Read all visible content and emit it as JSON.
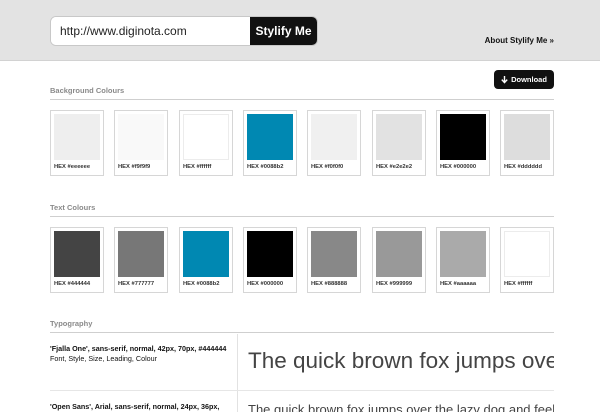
{
  "header": {
    "url_value": "http://www.diginota.com",
    "stylify_label": "Stylify Me",
    "about_label": "About Stylify Me »"
  },
  "download": {
    "label": "Download",
    "icon": "arrow-down-icon"
  },
  "background_section": {
    "title": "Background Colours",
    "swatches": [
      {
        "label": "HEX #eeeeee",
        "color": "#eeeeee"
      },
      {
        "label": "HEX #f9f9f9",
        "color": "#f9f9f9"
      },
      {
        "label": "HEX #ffffff",
        "color": "#ffffff"
      },
      {
        "label": "HEX #0088b2",
        "color": "#0088b2"
      },
      {
        "label": "HEX #f0f0f0",
        "color": "#f0f0f0"
      },
      {
        "label": "HEX #e2e2e2",
        "color": "#e2e2e2"
      },
      {
        "label": "HEX #000000",
        "color": "#000000"
      },
      {
        "label": "HEX #dddddd",
        "color": "#dddddd"
      }
    ]
  },
  "text_section": {
    "title": "Text Colours",
    "swatches": [
      {
        "label": "HEX #444444",
        "color": "#444444"
      },
      {
        "label": "HEX #777777",
        "color": "#777777"
      },
      {
        "label": "HEX #0088b2",
        "color": "#0088b2"
      },
      {
        "label": "HEX #000000",
        "color": "#000000"
      },
      {
        "label": "HEX #888888",
        "color": "#888888"
      },
      {
        "label": "HEX #999999",
        "color": "#999999"
      },
      {
        "label": "HEX #aaaaaa",
        "color": "#aaaaaa"
      },
      {
        "label": "HEX #ffffff",
        "color": "#ffffff"
      }
    ]
  },
  "typography": {
    "title": "Typography",
    "rows": [
      {
        "spec": "'Fjalla One', sans-serif, normal, 42px, 70px, #444444",
        "legend": "Font, Style, Size, Leading, Colour",
        "sample": "The quick brown fox jumps over the lazy dog"
      },
      {
        "spec": "'Open Sans', Arial, sans-serif, normal, 24px, 36px,",
        "legend": "",
        "sample": "The quick brown fox jumps over the lazy dog and feels"
      }
    ]
  }
}
